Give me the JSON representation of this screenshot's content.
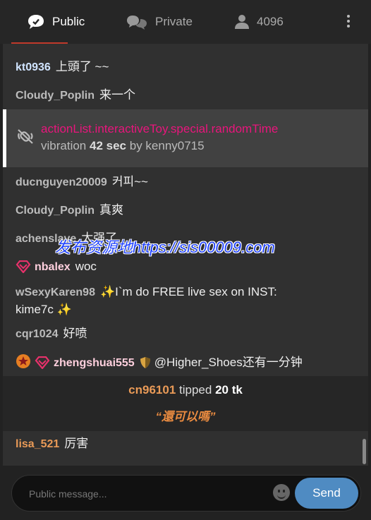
{
  "tabs": {
    "public": "Public",
    "private": "Private",
    "users": "4096"
  },
  "messages": [
    {
      "user": "kt0936",
      "text": "上頭了 ~~"
    },
    {
      "user": "Cloudy_Poplin",
      "text": "来一个"
    },
    {
      "user": "ducnguyen20009",
      "text": "커피~~"
    },
    {
      "user": "Cloudy_Poplin",
      "text": "真爽"
    },
    {
      "user": "achenslave",
      "text": "太强了"
    },
    {
      "user": "nbalex",
      "text": "woc"
    },
    {
      "user": "wSexyKaren98",
      "text": "✨I`m do FREE live sex on INST:",
      "text2": "kime7c ✨"
    },
    {
      "user": "cqr1024",
      "text": "好喷"
    },
    {
      "user": "zhengshuai555",
      "text": "@Higher_Shoes还有一分钟"
    },
    {
      "user": "lisa_521",
      "text": "厉害"
    }
  ],
  "system": {
    "action": "actionList.interactiveToy.special.randomTime",
    "detail_pre": "vibration",
    "detail_sec": "42 sec",
    "detail_post": "by kenny0715"
  },
  "tip": {
    "user": "cn96101",
    "verb": "tipped",
    "amount": "20 tk",
    "message": "“還可以嗎”"
  },
  "watermark": "发布资源地https://sis00009.com",
  "composer": {
    "placeholder": "Public message...",
    "send": "Send"
  },
  "colors": {
    "accent": "#4f8bc2",
    "system_text": "#e9157c",
    "tip_user": "#e99a57"
  }
}
